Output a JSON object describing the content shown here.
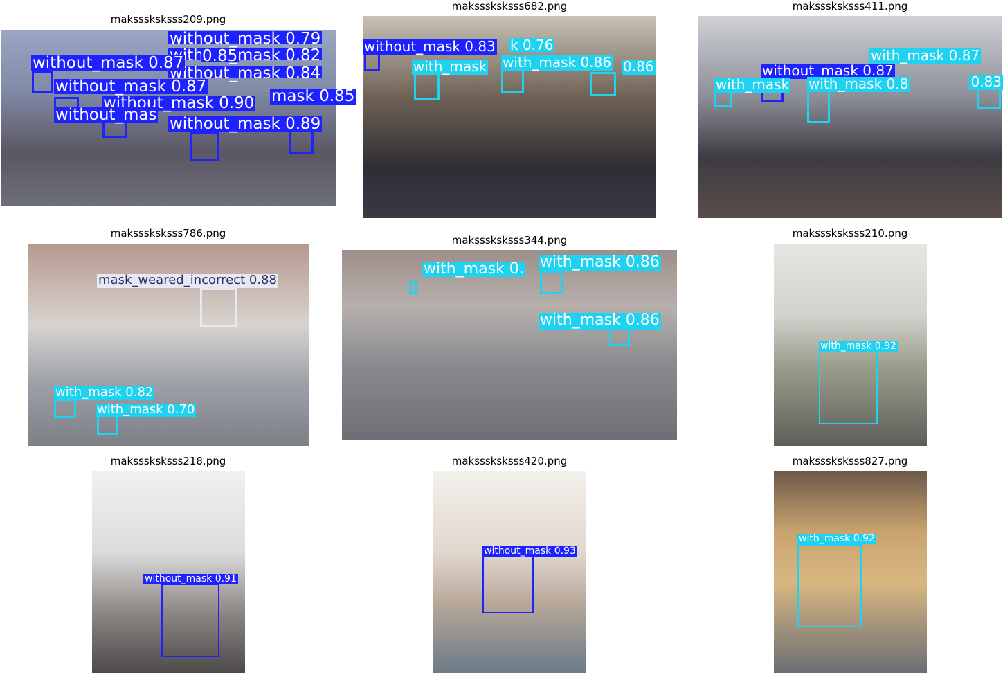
{
  "colors": {
    "with_mask": "#1ed2f0",
    "without_mask": "#1e22ff",
    "mask_weared_incorrect": "#e8e8f0"
  },
  "panels": [
    {
      "title": "maksssksksss209.png",
      "detections": [
        {
          "label": "without_mask 0.79",
          "cls": "without_mask"
        },
        {
          "label": "without_mask 0.82",
          "cls": "without_mask"
        },
        {
          "label": "without_mask 0.84",
          "cls": "without_mask"
        },
        {
          "label": "0.85",
          "cls": "without_mask"
        },
        {
          "label": "without_mask 0.87",
          "cls": "without_mask"
        },
        {
          "label": "without_mask 0.87",
          "cls": "without_mask"
        },
        {
          "label": "without_mask 0.90",
          "cls": "without_mask"
        },
        {
          "label": "mask 0.85",
          "cls": "without_mask"
        },
        {
          "label": "without_mask 0.89",
          "cls": "without_mask"
        },
        {
          "label": "without_mas",
          "cls": "without_mask"
        }
      ]
    },
    {
      "title": "maksssksksss682.png",
      "detections": [
        {
          "label": "without_mask 0.83",
          "cls": "without_mask"
        },
        {
          "label": "k 0.76",
          "cls": "with_mask"
        },
        {
          "label": "with_mask",
          "cls": "with_mask"
        },
        {
          "label": "with_mask 0.86",
          "cls": "with_mask"
        },
        {
          "label": "0.86",
          "cls": "with_mask"
        }
      ]
    },
    {
      "title": "maksssksksss411.png",
      "detections": [
        {
          "label": "with_mask 0.87",
          "cls": "with_mask"
        },
        {
          "label": "without_mask 0.87",
          "cls": "without_mask"
        },
        {
          "label": "with_mask",
          "cls": "with_mask"
        },
        {
          "label": "with_mask 0.8",
          "cls": "with_mask"
        },
        {
          "label": "0.83",
          "cls": "with_mask"
        }
      ]
    },
    {
      "title": "maksssksksss786.png",
      "detections": [
        {
          "label": "mask_weared_incorrect 0.88",
          "cls": "mask_weared_incorrect"
        },
        {
          "label": "with_mask 0.82",
          "cls": "with_mask"
        },
        {
          "label": "with_mask 0.70",
          "cls": "with_mask"
        }
      ]
    },
    {
      "title": "maksssksksss344.png",
      "detections": [
        {
          "label": "with_mask 0.",
          "cls": "with_mask"
        },
        {
          "label": "with_mask 0.86",
          "cls": "with_mask"
        },
        {
          "label": "with_mask 0.86",
          "cls": "with_mask"
        }
      ]
    },
    {
      "title": "maksssksksss210.png",
      "detections": [
        {
          "label": "with_mask 0.92",
          "cls": "with_mask"
        }
      ]
    },
    {
      "title": "maksssksksss218.png",
      "detections": [
        {
          "label": "without_mask 0.91",
          "cls": "without_mask"
        }
      ]
    },
    {
      "title": "maksssksksss420.png",
      "detections": [
        {
          "label": "without_mask 0.93",
          "cls": "without_mask"
        }
      ]
    },
    {
      "title": "maksssksksss827.png",
      "detections": [
        {
          "label": "with_mask 0.92",
          "cls": "with_mask"
        }
      ]
    }
  ]
}
